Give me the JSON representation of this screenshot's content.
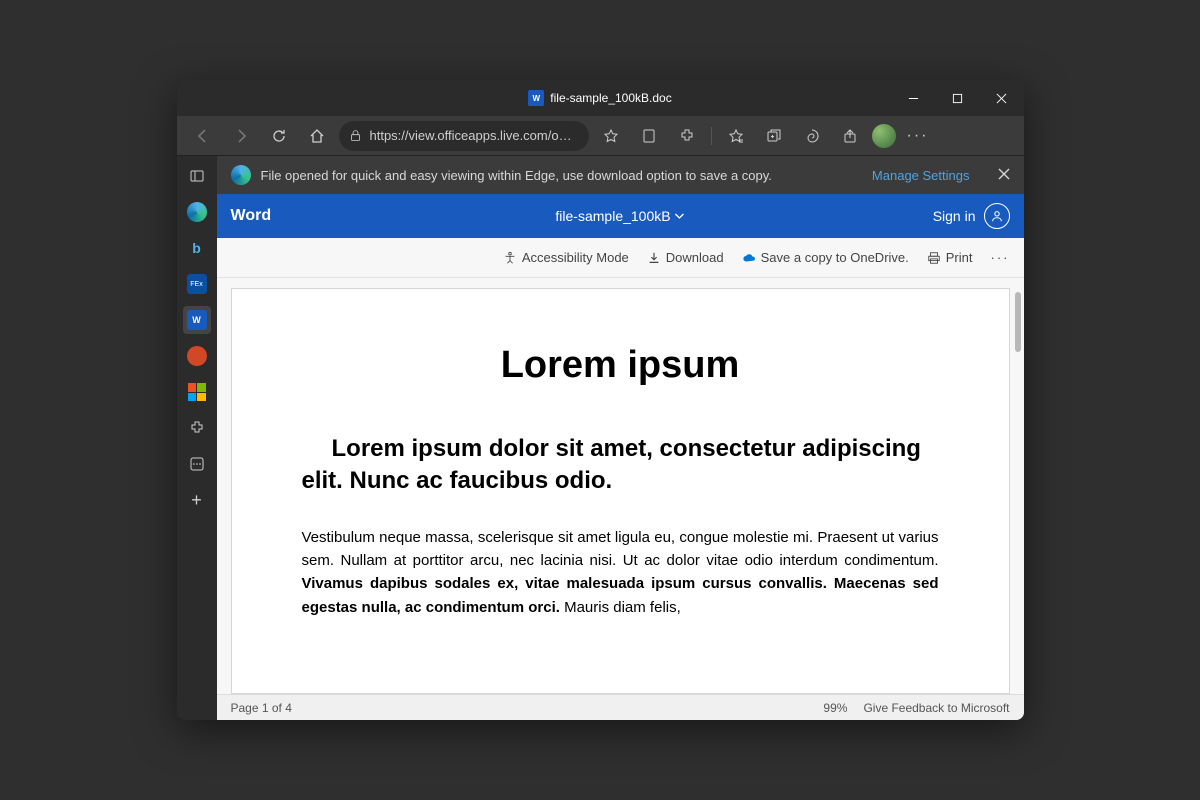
{
  "window": {
    "title": "file-sample_100kB.doc"
  },
  "toolbar": {
    "url": "https://view.officeapps.live.com/o…"
  },
  "info_bar": {
    "message": "File opened for quick and easy viewing within Edge, use download option to save a copy.",
    "manage": "Manage Settings"
  },
  "word_header": {
    "brand": "Word",
    "doc_name": "file-sample_100kB",
    "signin": "Sign in"
  },
  "action_bar": {
    "accessibility": "Accessibility Mode",
    "download": "Download",
    "onedrive": "Save a copy to OneDrive.",
    "print": "Print"
  },
  "document": {
    "title": "Lorem ipsum",
    "subtitle": "Lorem ipsum dolor sit amet, consectetur adipiscing elit. Nunc ac faucibus odio.",
    "body_pre": "Vestibulum neque massa, scelerisque sit amet ligula eu, congue molestie mi. Praesent ut varius sem. Nullam at porttitor arcu, nec lacinia nisi. Ut ac dolor vitae odio interdum condimentum. ",
    "body_bold": "Vivamus dapibus sodales ex, vitae malesuada ipsum cursus convallis. Maecenas sed egestas nulla, ac condimentum orci.",
    "body_post": " Mauris diam felis,"
  },
  "status": {
    "page": "Page 1 of 4",
    "zoom": "99%",
    "feedback": "Give Feedback to Microsoft"
  }
}
